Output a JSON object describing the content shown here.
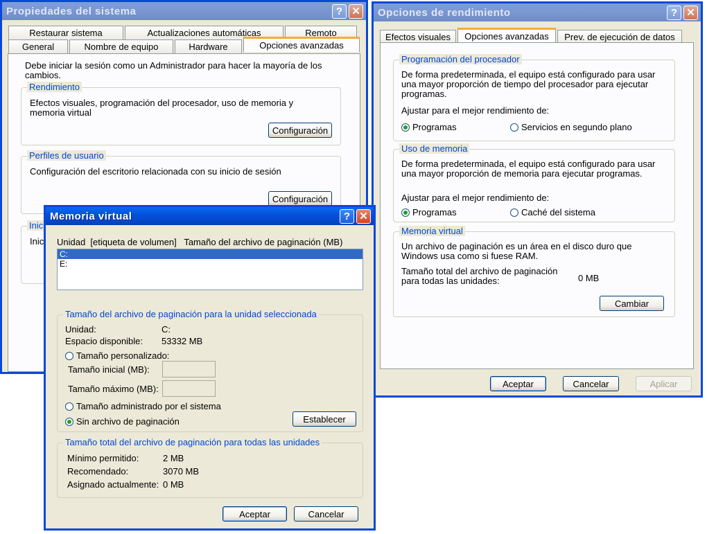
{
  "sys": {
    "title": "Propiedades del sistema",
    "tabs_row1": [
      "Restaurar sistema",
      "Actualizaciones automáticas",
      "Remoto"
    ],
    "tabs_row2": [
      "General",
      "Nombre de equipo",
      "Hardware",
      "Opciones avanzadas"
    ],
    "intro": "Debe iniciar la sesión como un Administrador para hacer la mayoría de los cambios.",
    "rend_label": "Rendimiento",
    "rend_text": "Efectos visuales, programación del procesador, uso de memoria y memoria virtual",
    "config_button": "Configuración",
    "perf_label": "Perfiles de usuario",
    "perf_text": "Configuración del escritorio relacionada con su inicio de sesión",
    "inicio_label": "Inici",
    "inicio_text": "Inic"
  },
  "perf": {
    "title": "Opciones de rendimiento",
    "tabs": [
      "Efectos visuales",
      "Opciones avanzadas",
      "Prev. de ejecución de datos"
    ],
    "proc": {
      "label": "Programación del procesador",
      "text": "De forma predeterminada, el equipo está configurado para usar una mayor proporción de tiempo del procesador para ejecutar programas.",
      "adjust": "Ajustar para el mejor rendimiento de:",
      "opt1": "Programas",
      "opt2": "Servicios en segundo plano"
    },
    "mem": {
      "label": "Uso de memoria",
      "text": "De forma predeterminada, el equipo está configurado para usar una mayor proporción de memoria para ejecutar programas.",
      "adjust": "Ajustar para el mejor rendimiento de:",
      "opt1": "Programas",
      "opt2": "Caché del sistema"
    },
    "vm": {
      "label": "Memoria virtual",
      "text": "Un archivo de paginación es un área en el disco duro que Windows usa como si fuese RAM.",
      "total_label": "Tamaño total del archivo de paginación para todas las unidades:",
      "total_value": "0 MB",
      "change_button": "Cambiar"
    },
    "ok": "Aceptar",
    "cancel": "Cancelar",
    "apply": "Aplicar"
  },
  "vm": {
    "title": "Memoria virtual",
    "header": "Unidad  [etiqueta de volumen]   Tamaño del archivo de paginación (MB)",
    "drives": [
      "C:",
      "E:"
    ],
    "sel_label": "Tamaño del archivo de paginación para la unidad seleccionada",
    "unidad_label": "Unidad:",
    "unidad_value": "C:",
    "espacio_label": "Espacio disponible:",
    "espacio_value": "53332 MB",
    "custom": "Tamaño personalizado:",
    "initial": "Tamaño inicial (MB):",
    "max": "Tamaño máximo (MB):",
    "managed": "Tamaño administrado por el sistema",
    "none": "Sin archivo de paginación",
    "set_button": "Establecer",
    "total_label": "Tamaño total del archivo de paginación para todas las unidades",
    "min_label": "Mínimo permitido:",
    "min_value": "2 MB",
    "rec_label": "Recomendado:",
    "rec_value": "3070 MB",
    "asig_label": "Asignado actualmente:",
    "asig_value": "0 MB",
    "ok": "Aceptar",
    "cancel": "Cancelar"
  }
}
